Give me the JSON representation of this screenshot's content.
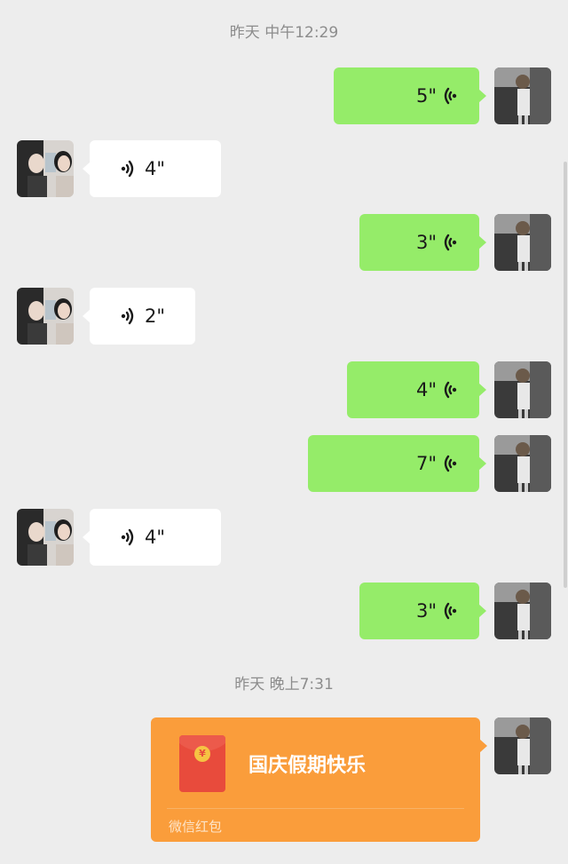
{
  "timestamps": {
    "t1": "昨天 中午12:29",
    "t2": "昨天 晚上7:31"
  },
  "messages": [
    {
      "direction": "out",
      "duration": "5\""
    },
    {
      "direction": "in",
      "duration": "4\""
    },
    {
      "direction": "out",
      "duration": "3\""
    },
    {
      "direction": "in",
      "duration": "2\""
    },
    {
      "direction": "out",
      "duration": "4\""
    },
    {
      "direction": "out",
      "duration": "7\""
    },
    {
      "direction": "in",
      "duration": "4\""
    },
    {
      "direction": "out",
      "duration": "3\""
    }
  ],
  "red_packet": {
    "title": "国庆假期快乐",
    "label": "微信红包",
    "coin_symbol": "¥"
  },
  "colors": {
    "outgoing_bubble": "#95ec69",
    "incoming_bubble": "#ffffff",
    "red_packet": "#fa9d3b",
    "background": "#ededed"
  },
  "icons": {
    "voice_outgoing": "voice-wave-icon",
    "voice_incoming": "voice-wave-icon",
    "red_packet": "red-envelope-icon"
  }
}
